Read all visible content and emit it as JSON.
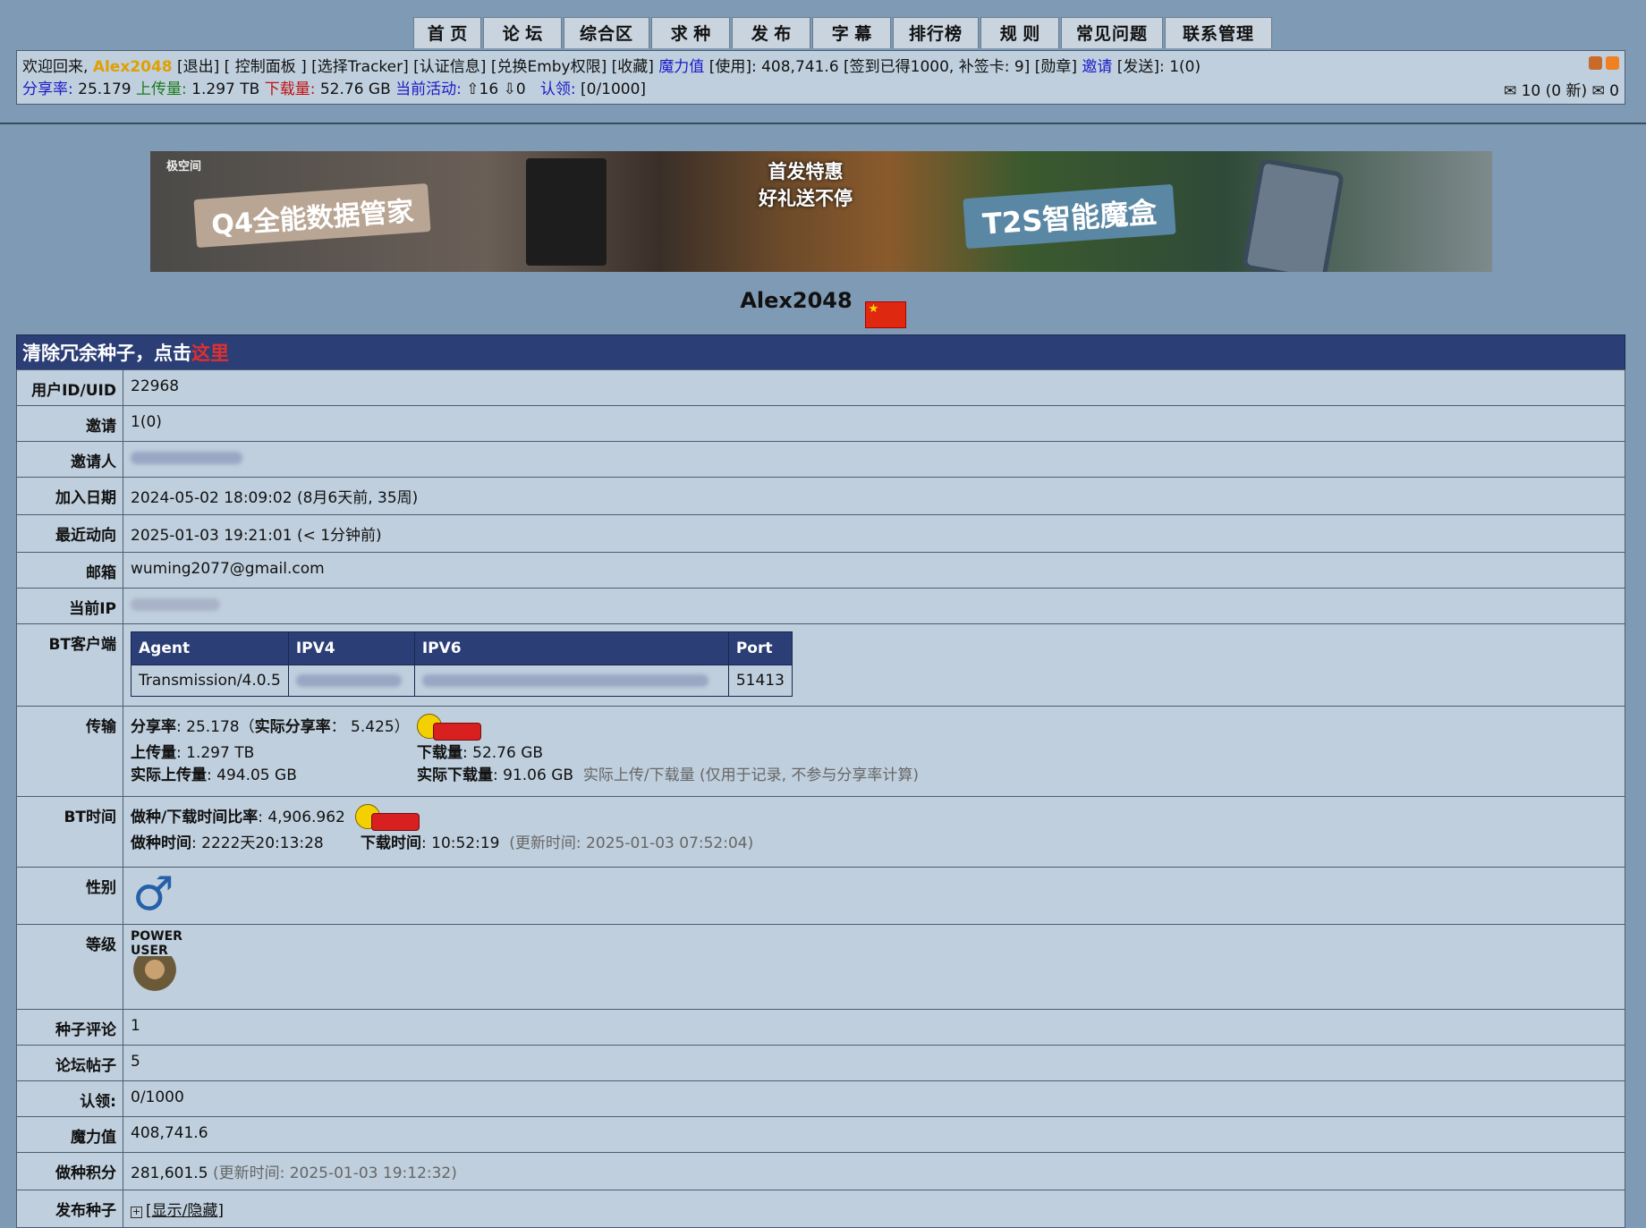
{
  "nav": {
    "tabs": [
      "首 页",
      "论 坛",
      "综合区",
      "求 种",
      "发 布",
      "字 幕",
      "排行榜",
      "规 则",
      "常见问题",
      "联系管理组"
    ]
  },
  "info": {
    "welcome": "欢迎回来, ",
    "username": "Alex2048",
    "links1": " [退出] [ 控制面板 ] [选择Tracker] [认证信息] [兑换Emby权限] [收藏] ",
    "bonus_label": "魔力值",
    "bonus_text": " [使用]: 408,741.6 [签到已得1000, 补签卡: 9] [勋章] ",
    "invite_label": "邀请",
    "invite_text": " [发送]: 1(0)",
    "ratio_label": "分享率:",
    "ratio_val": " 25.179 ",
    "up_label": "上传量:",
    "up_val": " 1.297 TB ",
    "down_label": "下载量:",
    "down_val": " 52.76 GB ",
    "active_label": "当前活动:",
    "active_val": " ⇧16 ⇩0",
    "claim_label": "认领:",
    "claim_val": " [0/1000]",
    "messages": "✉ 10 (0 新) ✉ 0"
  },
  "banner": {
    "logo": "极空间",
    "left": "Q4全能数据管家",
    "middle1": "首发特惠",
    "middle2": "好礼送不停",
    "right": "T2S智能魔盒"
  },
  "profile": {
    "name": "Alex2048",
    "flag_star": "★"
  },
  "title": {
    "prefix": "清除冗余种子，点击",
    "link": "这里"
  },
  "rows": {
    "uid": {
      "label": "用户ID/UID",
      "value": "22968"
    },
    "invites": {
      "label": "邀请",
      "value": "1(0)"
    },
    "inviter": {
      "label": "邀请人"
    },
    "joined": {
      "label": "加入日期",
      "value": "2024-05-02 18:09:02 (8月6天前, 35周)"
    },
    "last_seen": {
      "label": "最近动向",
      "value": "2025-01-03 19:21:01 (< 1分钟前)"
    },
    "email": {
      "label": "邮箱",
      "value": "wuming2077@gmail.com"
    },
    "ip": {
      "label": "当前IP"
    },
    "bt_client": {
      "label": "BT客户端",
      "headers": [
        "Agent",
        "IPV4",
        "IPV6",
        "Port"
      ],
      "agent": "Transmission/4.0.5",
      "port": "51413"
    },
    "transfer": {
      "label": "传输",
      "ratio_k": "分享率",
      "ratio_v": ": 25.178（",
      "real_ratio_k": "实际分享率",
      "real_ratio_v": "： 5.425）",
      "up_k": "上传量",
      "up_v": ": 1.297 TB",
      "down_k": "下载量",
      "down_v": ": 52.76 GB",
      "real_up_k": "实际上传量",
      "real_up_v": ": 494.05 GB",
      "real_down_k": "实际下载量",
      "real_down_v": ": 91.06 GB",
      "note": "实际上传/下载量 (仅用于记录, 不参与分享率计算)"
    },
    "bt_time": {
      "label": "BT时间",
      "ratio_k": "做种/下载时间比率",
      "ratio_v": ": 4,906.962",
      "seed_k": "做种时间",
      "seed_v": ": 2222天20:13:28",
      "leech_k": "下载时间",
      "leech_v": ": 10:52:19",
      "updated": "(更新时间: 2025-01-03 07:52:04)"
    },
    "gender": {
      "label": "性别",
      "symbol": "♂"
    },
    "class": {
      "label": "等级",
      "rank_text": "POWER USER"
    },
    "comments": {
      "label": "种子评论",
      "value": "1"
    },
    "posts": {
      "label": "论坛帖子",
      "value": "5"
    },
    "claims": {
      "label": "认领:",
      "value": "0/1000"
    },
    "bonus": {
      "label": "魔力值",
      "value": "408,741.6"
    },
    "seed_points": {
      "label": "做种积分",
      "value": "281,601.5",
      "updated": "(更新时间: 2025-01-03 19:12:32)"
    },
    "uploads": {
      "label": "发布种子",
      "toggle": "+",
      "link": "[显示/隐藏]"
    }
  }
}
